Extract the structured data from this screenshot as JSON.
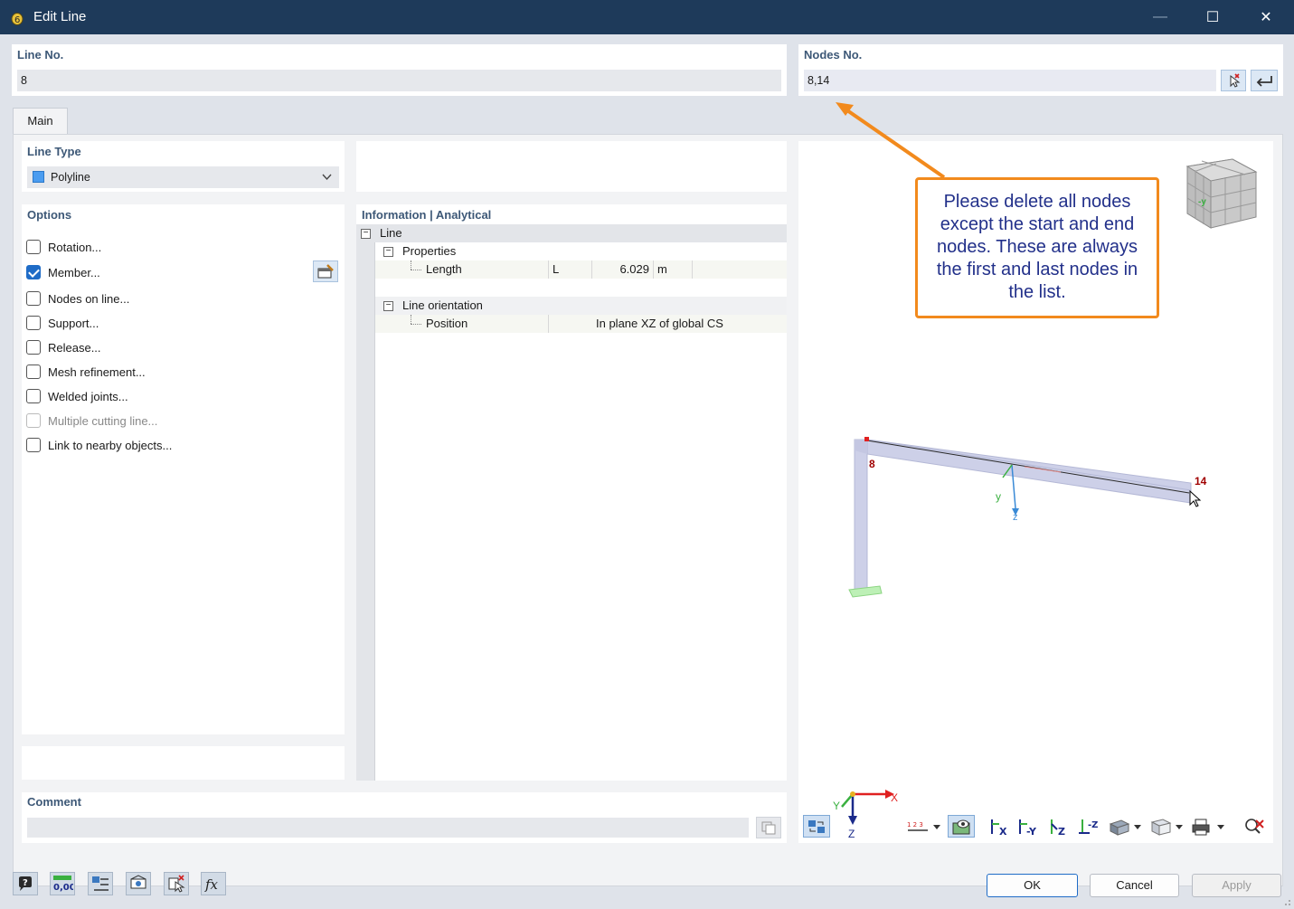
{
  "window": {
    "title": "Edit Line",
    "minimize_glyph": "—",
    "maximize_glyph": "☐",
    "close_glyph": "✕"
  },
  "line_no": {
    "label": "Line No.",
    "value": "8"
  },
  "nodes_no": {
    "label": "Nodes No.",
    "value": "8,14"
  },
  "tabs": [
    {
      "label": "Main"
    }
  ],
  "line_type": {
    "label": "Line Type",
    "value": "Polyline",
    "swatch_color": "#4a9cf0"
  },
  "options": {
    "label": "Options",
    "items": [
      {
        "label": "Rotation...",
        "checked": false
      },
      {
        "label": "Member...",
        "checked": true
      },
      {
        "label": "Nodes on line...",
        "checked": false
      },
      {
        "label": "Support...",
        "checked": false
      },
      {
        "label": "Release...",
        "checked": false
      },
      {
        "label": "Mesh refinement...",
        "checked": false
      },
      {
        "label": "Welded joints...",
        "checked": false
      },
      {
        "label": "Multiple cutting line...",
        "checked": false,
        "disabled": true
      },
      {
        "label": "Link to nearby objects...",
        "checked": false
      }
    ]
  },
  "info": {
    "label": "Information | Analytical",
    "root": "Line",
    "properties": {
      "label": "Properties",
      "length_label": "Length",
      "length_symbol": "L",
      "length_value": "6.029",
      "length_unit": "m"
    },
    "orientation": {
      "label": "Line orientation",
      "position_label": "Position",
      "position_value": "In plane XZ of global CS"
    }
  },
  "comment": {
    "label": "Comment",
    "value": ""
  },
  "viewport": {
    "node_start": "8",
    "node_end": "14",
    "local_axis_y": "y",
    "local_axis_z": "z",
    "global_axis_x": "X",
    "global_axis_y": "Y",
    "global_axis_z": "Z",
    "cube_label": "-y"
  },
  "callout": {
    "text": "Please delete all nodes except the start and end nodes. These are always the first and last nodes in the list."
  },
  "buttons": {
    "ok": "OK",
    "cancel": "Cancel",
    "apply": "Apply"
  },
  "bottom_tools": [
    "help-icon",
    "units-icon",
    "text-style-icon",
    "model-view-icon",
    "select-object-icon",
    "function-icon"
  ],
  "bottom_units_text": "0,00",
  "colors": {
    "accent": "#1f6cc7",
    "titlebar": "#1e3a5a",
    "callout_border": "#f28a1d",
    "callout_text": "#22308a",
    "node_red": "#a00000"
  }
}
